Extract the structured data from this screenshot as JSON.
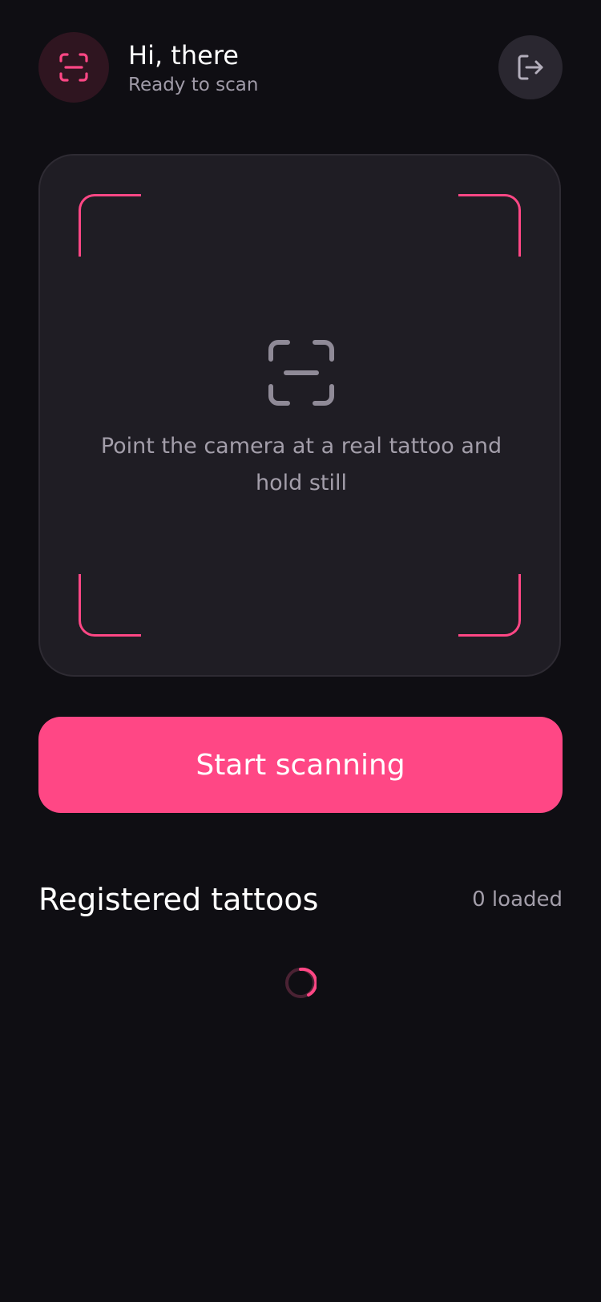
{
  "header": {
    "title": "Hi, there",
    "subtitle": "Ready to scan",
    "avatar_icon": "scan-icon",
    "logout_icon": "logout-icon"
  },
  "scanner": {
    "hint": "Point the camera at a real tattoo and hold still",
    "center_icon": "scan-icon"
  },
  "actions": {
    "start_label": "Start scanning"
  },
  "registered": {
    "title": "Registered tattoos",
    "count_label": "0 loaded",
    "loading_icon": "spinner-icon"
  },
  "colors": {
    "background": "#0f0e13",
    "accent": "#ff4785",
    "card": "#1f1d24",
    "muted_text": "#a39eaa"
  }
}
